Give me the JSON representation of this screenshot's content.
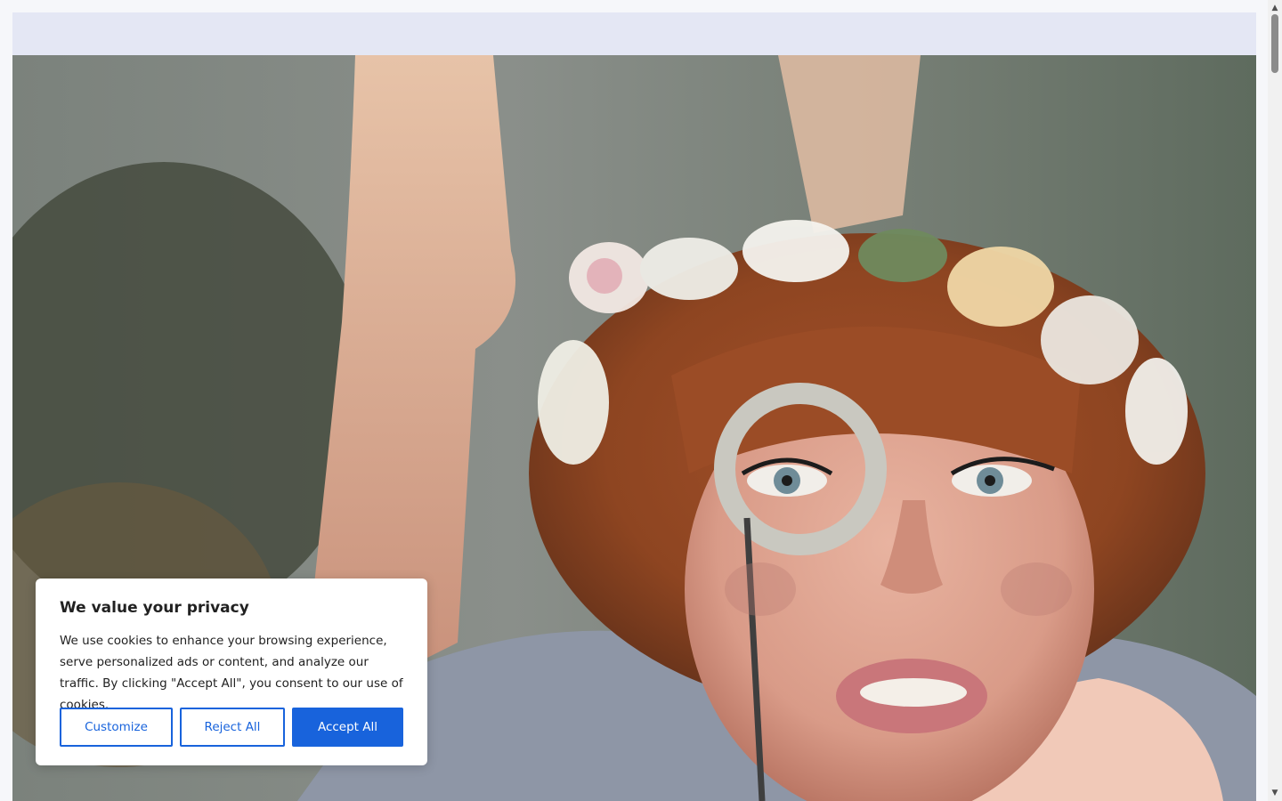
{
  "scrollbar": {
    "up_arrow_icon": "arrow-up",
    "down_arrow_icon": "arrow-down"
  },
  "cookie_banner": {
    "title": "We value your privacy",
    "text": "We use cookies to enhance your browsing experience, serve personalized ads or content, and analyze our traffic. By clicking \"Accept All\", you consent to our use of cookies.",
    "buttons": {
      "customize": "Customize",
      "reject": "Reject All",
      "accept": "Accept All"
    },
    "accent_color": "#1863dc"
  }
}
